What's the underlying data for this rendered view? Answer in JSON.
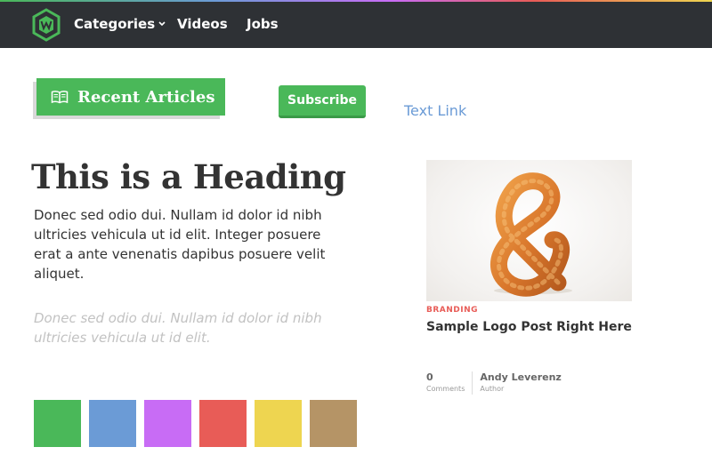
{
  "nav": {
    "items": [
      {
        "label": "Categories"
      },
      {
        "label": "Videos"
      },
      {
        "label": "Jobs"
      }
    ]
  },
  "recent_articles": {
    "label": "Recent Articles",
    "icon": "book-icon"
  },
  "subscribe": {
    "label": "Subscribe"
  },
  "text_link": {
    "label": "Text Link"
  },
  "heading": "This is a Heading",
  "body_text": "Donec sed odio dui. Nullam id dolor id nibh ultricies vehicula ut id elit. Integer posuere erat a ante venenatis dapibus posuere velit aliquet.",
  "muted_text": "Donec sed odio dui. Nullam id dolor id nibh ultricies vehicula ut id elit.",
  "swatches": [
    "#4ab859",
    "#6b9bd6",
    "#c86cf5",
    "#e85c57",
    "#eed550",
    "#b59466"
  ],
  "card": {
    "category": "BRANDING",
    "title": "Sample Logo Post Right Here",
    "comments_count": "0",
    "comments_label": "Comments",
    "author_name": "Andy Leverenz",
    "author_label": "Author"
  },
  "colors": {
    "nav_bg": "#2e3135",
    "accent_green": "#4ab859",
    "link_blue": "#6b9bd6",
    "category_red": "#e85c57"
  }
}
